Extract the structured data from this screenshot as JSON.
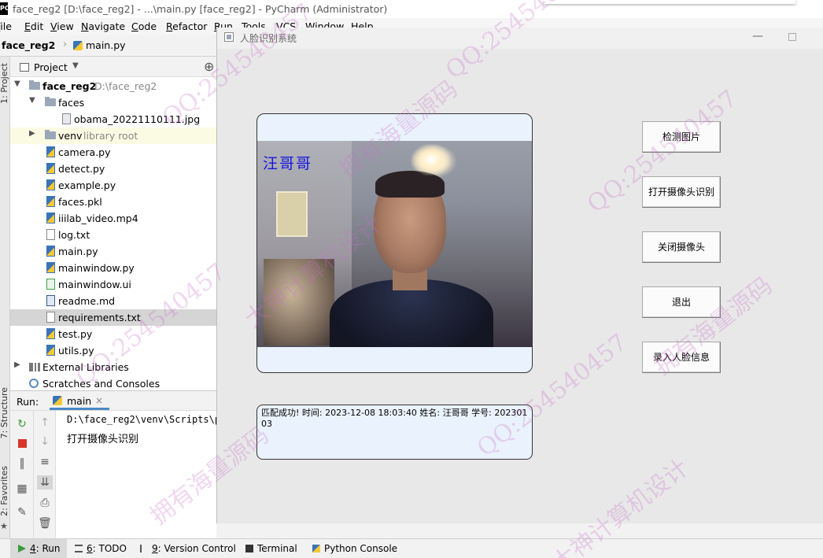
{
  "ide": {
    "app_icon": "PC",
    "window_title": "face_reg2 [D:\\face_reg2] - ...\\main.py [face_reg2] - PyCharm (Administrator)",
    "menu": [
      "File",
      "Edit",
      "View",
      "Navigate",
      "Code",
      "Refactor",
      "Run",
      "Tools",
      "VCS",
      "Window",
      "Help"
    ],
    "breadcrumb": {
      "project": "face_reg2",
      "file": "main.py"
    },
    "project_panel": {
      "title": "Project",
      "tree": [
        {
          "label": "face_reg2",
          "hint": "D:\\face_reg2",
          "type": "root-folder",
          "expanded": true
        },
        {
          "label": "faces",
          "type": "folder",
          "expanded": true
        },
        {
          "label": "obama_20221110111.jpg",
          "type": "image"
        },
        {
          "label": "venv",
          "hint": "library root",
          "type": "folder",
          "expanded": false
        },
        {
          "label": "camera.py",
          "type": "py"
        },
        {
          "label": "detect.py",
          "type": "py"
        },
        {
          "label": "example.py",
          "type": "py"
        },
        {
          "label": "faces.pkl",
          "type": "py"
        },
        {
          "label": "iiilab_video.mp4",
          "type": "py"
        },
        {
          "label": "log.txt",
          "type": "text"
        },
        {
          "label": "main.py",
          "type": "py"
        },
        {
          "label": "mainwindow.py",
          "type": "py"
        },
        {
          "label": "mainwindow.ui",
          "type": "ui"
        },
        {
          "label": "readme.md",
          "type": "md"
        },
        {
          "label": "requirements.txt",
          "type": "text",
          "selected": true
        },
        {
          "label": "test.py",
          "type": "py"
        },
        {
          "label": "utils.py",
          "type": "py"
        },
        {
          "label": "External Libraries",
          "type": "libraries",
          "expanded": false
        },
        {
          "label": "Scratches and Consoles",
          "type": "scratches"
        }
      ]
    },
    "side_tabs": {
      "project": "1: Project",
      "structure": "7: Structure",
      "favorites": "2: Favorites"
    },
    "run_panel": {
      "label": "Run:",
      "tab": "main",
      "console_lines": [
        "D:\\face_reg2\\venv\\Scripts\\p",
        "打开摄像头识别"
      ]
    },
    "status_tabs": [
      {
        "num": "4",
        "label": "Run",
        "active": true
      },
      {
        "num": "6",
        "label": "TODO"
      },
      {
        "num": "9",
        "label": "Version Control"
      },
      {
        "num": "",
        "label": "Terminal"
      },
      {
        "num": "",
        "label": "Python Console"
      }
    ]
  },
  "app": {
    "title": "人脸识别系统",
    "video_name_overlay": "汪哥哥",
    "buttons": [
      "检测图片",
      "打开摄像头识别",
      "关闭摄像头",
      "退出",
      "录入人脸信息"
    ],
    "result_text": "匹配成功! 时间: 2023-12-08 18:03:40 姓名: 汪哥哥 学号: 20230103"
  },
  "watermarks": [
    "QQ:254540457",
    "大神计算机设计",
    "拥有海量源码"
  ]
}
